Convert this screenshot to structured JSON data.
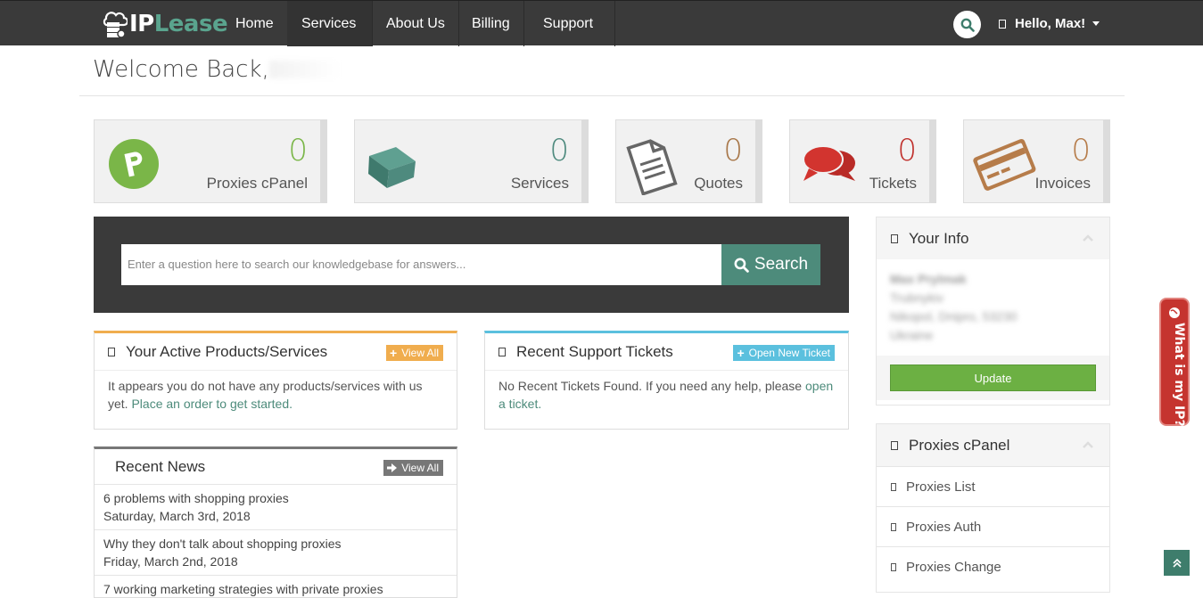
{
  "nav": {
    "logo": {
      "ip": "IP",
      "lease": "Lease"
    },
    "items": [
      "Home",
      "Services",
      "About Us",
      "Billing",
      "Support"
    ],
    "user_label": "Hello, Max!"
  },
  "welcome": {
    "text": "Welcome Back,"
  },
  "tiles": [
    {
      "count": "0",
      "label": "Proxies cPanel",
      "color": "#7ab648"
    },
    {
      "count": "0",
      "label": "Services",
      "color": "#4e8a7e"
    },
    {
      "count": "0",
      "label": "Quotes",
      "color": "#a87749"
    },
    {
      "count": "0",
      "label": "Tickets",
      "color": "#c0302c"
    },
    {
      "count": "0",
      "label": "Invoices",
      "color": "#b67c4a"
    }
  ],
  "kb": {
    "placeholder": "Enter a question here to search our knowledgebase for answers...",
    "button": "Search"
  },
  "products": {
    "title": "Your Active Products/Services",
    "tag": "View All",
    "text": "It appears you do not have any products/services with us yet.",
    "link": "Place an order to get started."
  },
  "tickets": {
    "title": "Recent Support Tickets",
    "tag": "Open New Ticket",
    "text": "No Recent Tickets Found. If you need any help, please",
    "link": "open a ticket."
  },
  "news": {
    "title": "Recent News",
    "tag": "View All",
    "items": [
      {
        "title": "6 problems with shopping proxies",
        "date": "Saturday, March 3rd, 2018"
      },
      {
        "title": "Why they don't talk about shopping proxies",
        "date": "Friday, March 2nd, 2018"
      },
      {
        "title": "7 working marketing strategies with private proxies",
        "date": ""
      }
    ]
  },
  "your_info": {
    "title": "Your Info",
    "lines": [
      "Max Prylmak",
      "Trubnykiv",
      "Nikopol, Dnipro, 53230",
      "Ukraine"
    ],
    "update": "Update"
  },
  "proxies_panel": {
    "title": "Proxies cPanel",
    "links": [
      "Proxies List",
      "Proxies Auth",
      "Proxies Change"
    ]
  },
  "ip_button": "What is my IP?"
}
